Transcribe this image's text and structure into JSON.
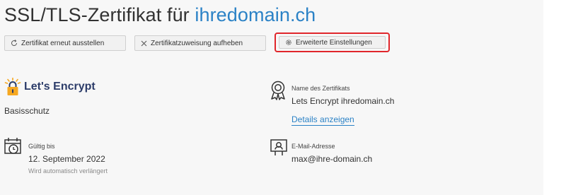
{
  "header": {
    "title_prefix": "SSL/TLS-Zertifikat für ",
    "title_domain": "ihredomain.ch"
  },
  "toolbar": {
    "reissue_label": "Zertifikat erneut ausstellen",
    "unassign_label": "Zertifikatzuweisung aufheben",
    "advanced_label": "Erweiterte Einstellungen"
  },
  "provider": {
    "name": "Let's Encrypt",
    "tier": "Basisschutz"
  },
  "certificate": {
    "name_label": "Name des Zertifikats",
    "name_value": "Lets Encrypt ihredomain.ch",
    "details_link": "Details anzeigen"
  },
  "validity": {
    "label": "Gültig bis",
    "value": "12. September 2022",
    "note": "Wird automatisch verlängert"
  },
  "email": {
    "label": "E-Mail-Adresse",
    "value": "max@ihre-domain.ch"
  },
  "colors": {
    "accent": "#2b82c6",
    "highlight": "#e0262b",
    "brand": "#2c3c69",
    "brand_lock": "#f6a821"
  }
}
